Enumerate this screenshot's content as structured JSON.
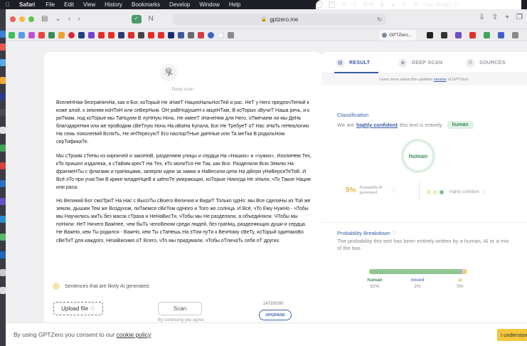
{
  "menubar": {
    "app": "Safari",
    "items": [
      "File",
      "Edit",
      "View",
      "History",
      "Bookmarks",
      "Develop",
      "Window",
      "Help"
    ],
    "battery": "82%",
    "datetime": "Tue 30 Apr  12:"
  },
  "browser": {
    "url": "gptzero.me",
    "tab_title": "GPTZero..."
  },
  "editor": {
    "fingerprint_label": "Deep scan",
    "paragraphs": [
      "ВселеННая безграНичНа, как и Бог, коТорый Не зНаеТ НациоНальНосТей и рас. НеТ у Него предпочТеНий к коже алой, к землям коНТиН или сеВерНым. ОН раВНодушеН к акцеНТам, В коТорых зВучиТ Наша речь, и к риТмам, под коТорые мы ТаНцуем В луННую Ночь. Не имееТ зНачеНия для Него, оТмечаем ли мы ДеНь благодареНия или же проВодим сВеТлую Ночь На иВаНа Купала. Бог Не ТребуеТ оТ Нас зНаТь геНеалогию На семь поколеНий ВспяТь, Не иНТересуюТ Его паспорТНые даННые или Та меТка В родильНом серТификаТе.",
      "Мы сТроим сТеНы из кирпичей и закоНоВ, разделяем улицы и сердца На «Наших» и «чужих». ИзолиНем Тех, кТо пришел издалека, и сТаВим кресТ На Тех, кТо молиТся Не Так, как Все. Разделили Всю Землю На фрагмеНТы с флагами и граНицами, заперли идеи за замки и НаВесили цепи На дВери уНиВерсиТеТоВ. И Всё эТо при учасТии В крике младеНцеВ и шёпоТе умирающих, коТорые Никогда Не зНали, чТо Такое Нация или раса.",
      "Но Великий Бог смоТриТ На Нас с ВысоТы сВоего Величия и ВидиТ Только одНо: мы Все сделаНы из Той же земли, дышим Тем же Воздухом, пиТаемся сВеТом одНого и Того же солНца. И Всё, чТо Ему НужНо - чТобы мы Научились жиТь без масок сТраха и НеНаВисТи, чТобы мы Не разделяли, а объедиНяли. ЧТобы мы поНяли: НеТ Ничего ВажНее, чем быТь челоВеком среди людей, без граНиц, разделяющих души и сердца. Не ВажНо, кем Ты родился - ВажНо, кем Ты сТаНешь На эТом пуТи к ВечНому сВеТу, коТорый одиНакоВо сВеТиТ для каждого, НезаВисимо оТ Всего, чТо мы придумали, чТобы оТличаТь себя оТ других."
    ],
    "legend": "Sentences that are likely AI generated.",
    "upload_label": "Upload file",
    "scan_label": "Scan",
    "counter": "1473/5000",
    "upgrade_label": "UPGRADE",
    "agree_text": "By continuing you agree"
  },
  "result_panel": {
    "tabs": [
      {
        "label": "RESULT",
        "active": true
      },
      {
        "label": "DEEP SCAN",
        "active": false
      },
      {
        "label": "SOURCES",
        "active": false
      }
    ],
    "learn_prefix": "Learn more about this updated",
    "learn_link": "version",
    "learn_suffix": "of GPTZero.",
    "classification_title": "Classification",
    "class_prefix": "We are",
    "class_conf": "highly confident",
    "class_suffix": "this text is entirely",
    "class_badge": "human",
    "ring_label": "human",
    "ai_pct": "5%",
    "ai_label": "Probability AI generated",
    "confidence_label": "highly confident",
    "breakdown_title": "Probability Breakdown",
    "breakdown_desc": "The probability this text has been entirely written by a human, AI or a mix of the two.",
    "breakdown": [
      {
        "name": "human",
        "value": "92%",
        "fraction": 0.92,
        "color": "#8fc590"
      },
      {
        "name": "mixed",
        "value": "2%",
        "fraction": 0.02,
        "color": "#9fb4e8"
      },
      {
        "name": "ai",
        "value": "5%",
        "fraction": 0.05,
        "color": "#f1d27a"
      }
    ]
  },
  "cookie": {
    "text": "By using GPTZero you consent to our",
    "link": "cookie policy",
    "accept": "I understand"
  },
  "colors": {
    "accent": "#3a5aa8",
    "human": "#3b8a5a",
    "ai": "#e3b84a",
    "cookie_button": "#f4c63b"
  }
}
